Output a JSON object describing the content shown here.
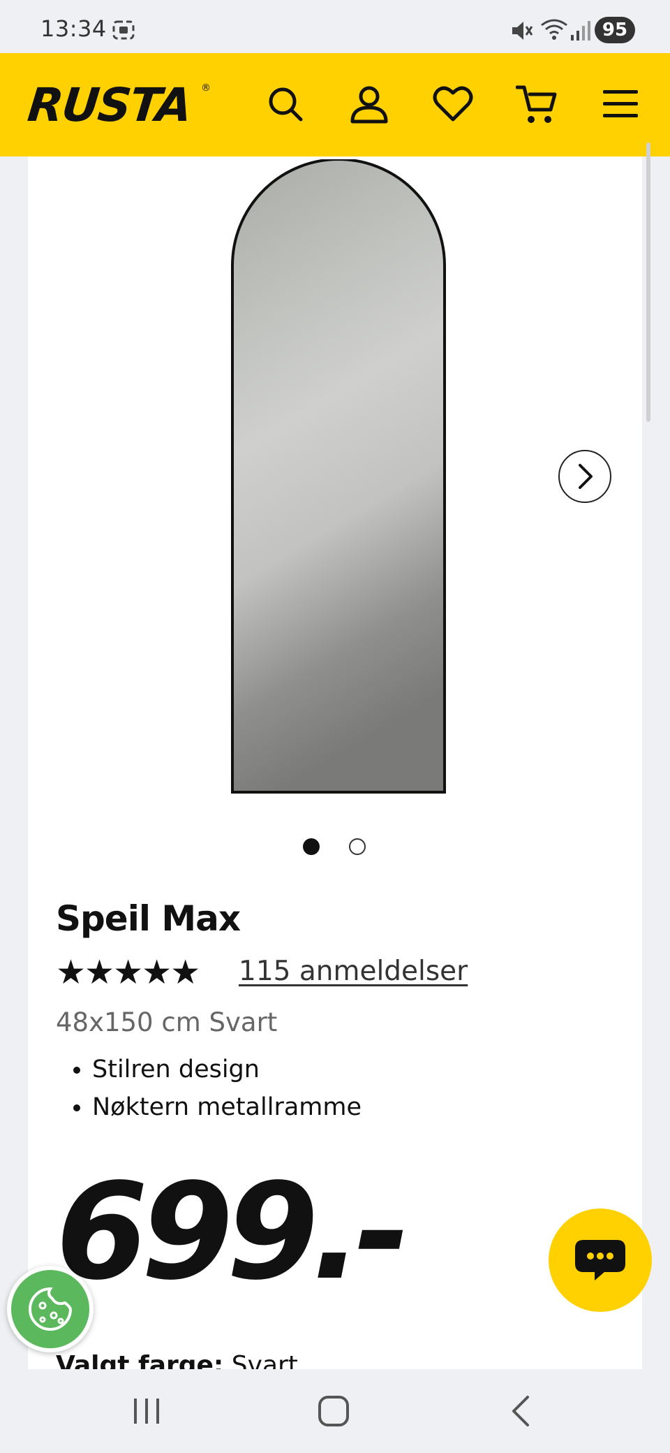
{
  "status_bar": {
    "time": "13:34",
    "battery": "95",
    "icons": [
      "screenshot-icon",
      "mute-icon",
      "wifi-icon",
      "signal-icon"
    ]
  },
  "header": {
    "logo": "RUSTA",
    "logo_mark": "®",
    "icons": [
      "search-icon",
      "account-icon",
      "heart-icon",
      "cart-icon",
      "menu-icon"
    ],
    "accent_color": "#ffd100"
  },
  "gallery": {
    "image_count": 2,
    "active_index": 0
  },
  "product": {
    "title": "Speil Max",
    "stars": "★★★★★",
    "rating_out_of_5": 5,
    "reviews_link": "115 anmeldelser",
    "variant": "48x150 cm Svart",
    "bullets": [
      "Stilren design",
      "Nøktern metallramme"
    ],
    "price": "699.-",
    "selected_color_label": "Valgt farge:",
    "selected_color_value": "Svart"
  },
  "floating": {
    "chat_color": "#ffd100",
    "cookie_color": "#5cb85c"
  },
  "nav_bar": {
    "icons": [
      "recent-apps-icon",
      "home-icon",
      "back-icon"
    ]
  }
}
